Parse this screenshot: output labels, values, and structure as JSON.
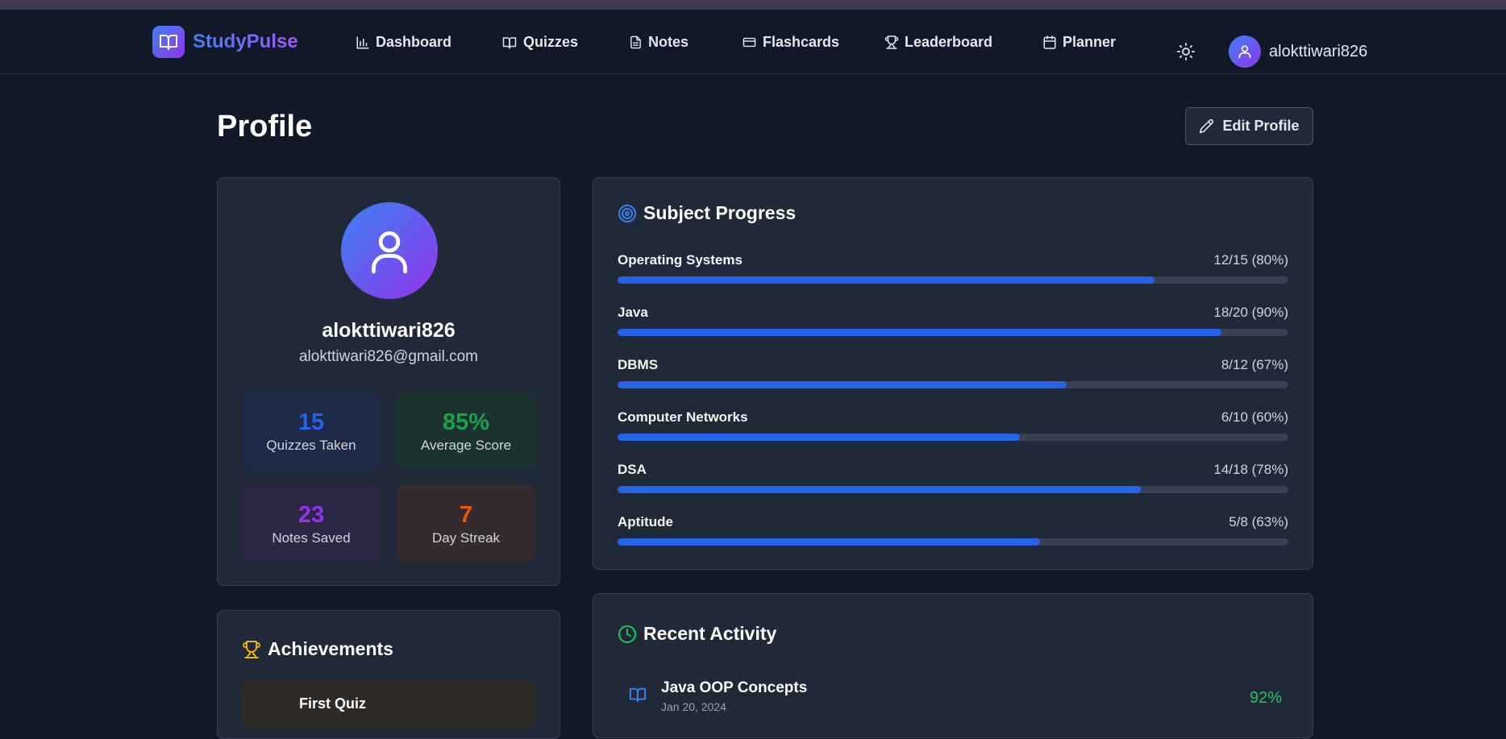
{
  "header": {
    "brand": "StudyPulse",
    "nav": [
      {
        "label": "Dashboard",
        "icon": "bar-chart-icon"
      },
      {
        "label": "Quizzes",
        "icon": "book-open-icon"
      },
      {
        "label": "Notes",
        "icon": "file-text-icon"
      },
      {
        "label": "Flashcards",
        "icon": "credit-card-icon"
      },
      {
        "label": "Leaderboard",
        "icon": "trophy-icon"
      },
      {
        "label": "Planner",
        "icon": "calendar-icon"
      }
    ],
    "username": "alokttiwari826"
  },
  "page": {
    "title": "Profile",
    "edit_label": "Edit Profile"
  },
  "profile": {
    "name": "alokttiwari826",
    "email": "alokttiwari826@gmail.com",
    "stats": [
      {
        "value": "15",
        "label": "Quizzes Taken",
        "color": "#2563eb",
        "bg": "#1e2a47"
      },
      {
        "value": "85%",
        "label": "Average Score",
        "color": "#16a34a",
        "bg": "#1c3230"
      },
      {
        "value": "23",
        "label": "Notes Saved",
        "color": "#9333ea",
        "bg": "#2c2744"
      },
      {
        "value": "7",
        "label": "Day Streak",
        "color": "#ea580c",
        "bg": "#352a2e"
      }
    ]
  },
  "achievements": {
    "heading": "Achievements",
    "items": [
      {
        "title": "First Quiz"
      }
    ]
  },
  "progress": {
    "heading": "Subject Progress",
    "subjects": [
      {
        "name": "Operating Systems",
        "count": "12/15 (80%)",
        "fraction": 0.8
      },
      {
        "name": "Java",
        "count": "18/20 (90%)",
        "fraction": 0.9
      },
      {
        "name": "DBMS",
        "count": "8/12 (67%)",
        "fraction": 0.67
      },
      {
        "name": "Computer Networks",
        "count": "6/10 (60%)",
        "fraction": 0.6
      },
      {
        "name": "DSA",
        "count": "14/18 (78%)",
        "fraction": 0.78
      },
      {
        "name": "Aptitude",
        "count": "5/8 (63%)",
        "fraction": 0.63
      }
    ]
  },
  "activity": {
    "heading": "Recent Activity",
    "items": [
      {
        "title": "Java OOP Concepts",
        "date": "Jan 20, 2024",
        "score": "92%"
      }
    ]
  }
}
